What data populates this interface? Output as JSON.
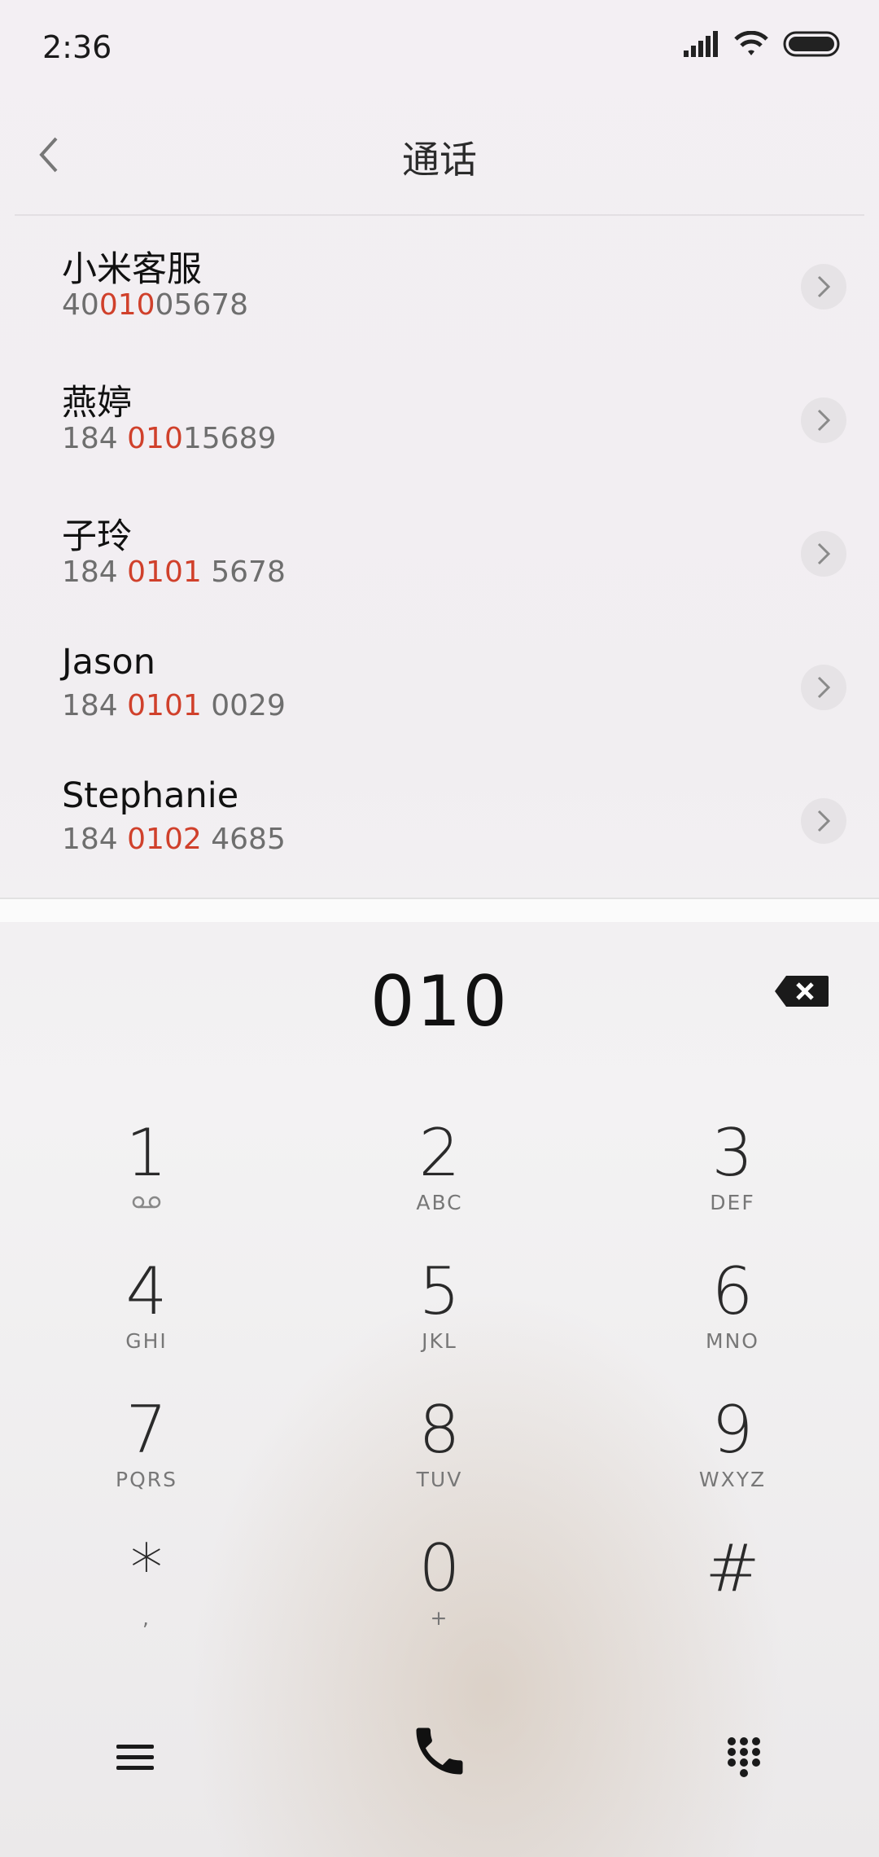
{
  "status_bar": {
    "time": "2:36"
  },
  "header": {
    "title": "通话"
  },
  "contacts": [
    {
      "name": "小米客服",
      "num_pre": "40",
      "num_hl": "010",
      "num_post": "05678"
    },
    {
      "name": "燕婷",
      "num_pre": "184 ",
      "num_hl": "010",
      "num_post": "15689"
    },
    {
      "name": "子玲",
      "num_pre": "184 ",
      "num_hl": "0101",
      "num_post": " 5678"
    },
    {
      "name": "Jason",
      "num_pre": "184 ",
      "num_hl": "0101",
      "num_post": " 0029"
    },
    {
      "name": "Stephanie",
      "num_pre": "184 ",
      "num_hl": "0102",
      "num_post": " 4685"
    }
  ],
  "dialer": {
    "entered_number": "010"
  },
  "keypad": [
    {
      "digit": "1",
      "letters": ""
    },
    {
      "digit": "2",
      "letters": "ABC"
    },
    {
      "digit": "3",
      "letters": "DEF"
    },
    {
      "digit": "4",
      "letters": "GHI"
    },
    {
      "digit": "5",
      "letters": "JKL"
    },
    {
      "digit": "6",
      "letters": "MNO"
    },
    {
      "digit": "7",
      "letters": "PQRS"
    },
    {
      "digit": "8",
      "letters": "TUV"
    },
    {
      "digit": "9",
      "letters": "WXYZ"
    },
    {
      "digit": "*",
      "letters": ","
    },
    {
      "digit": "0",
      "letters": "+"
    },
    {
      "digit": "#",
      "letters": ""
    }
  ],
  "icons": {
    "back": "chevron-left-icon",
    "signal": "signal-icon",
    "wifi": "wifi-icon",
    "battery": "battery-icon",
    "row_action": "chevron-right-icon",
    "backspace": "backspace-icon",
    "voicemail": "voicemail-icon",
    "menu": "menu-icon",
    "call": "phone-icon",
    "keypad_toggle": "dialpad-icon"
  },
  "colors": {
    "highlight": "#d0402b",
    "text": "#111111",
    "secondary": "#6e6e6e"
  }
}
